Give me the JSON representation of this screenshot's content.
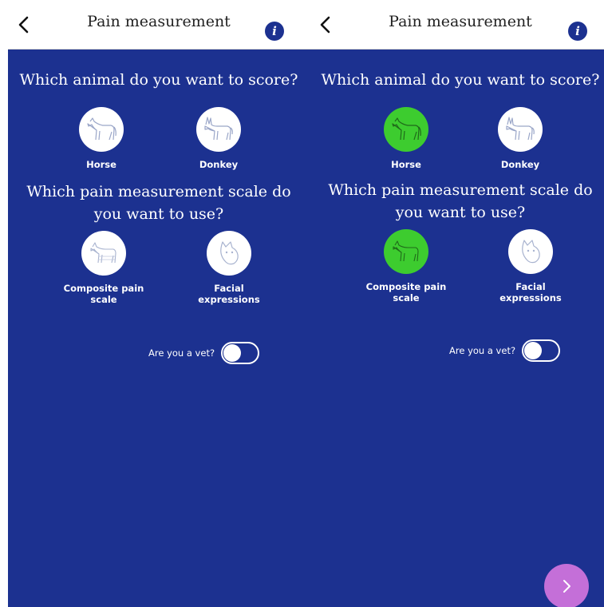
{
  "screens": [
    {
      "header": {
        "title": "Pain measurement"
      },
      "animal_question": "Which animal do you want to score?",
      "animals": [
        {
          "label": "Horse",
          "icon": "horse-icon",
          "selected": false
        },
        {
          "label": "Donkey",
          "icon": "donkey-icon",
          "selected": false
        }
      ],
      "scale_question_line1": "Which pain measurement scale do",
      "scale_question_line2": "you want to use?",
      "scales": [
        {
          "label_line1": "Composite pain",
          "label_line2": "scale",
          "icon": "horse-body-icon",
          "selected": false
        },
        {
          "label_line1": "Facial",
          "label_line2": "expressions",
          "icon": "horse-face-icon",
          "selected": false
        }
      ],
      "vet_label": "Are you a vet?",
      "vet_toggle_on": false
    },
    {
      "header": {
        "title": "Pain measurement"
      },
      "animal_question": "Which animal do you want to score?",
      "animals": [
        {
          "label": "Horse",
          "icon": "horse-icon",
          "selected": true
        },
        {
          "label": "Donkey",
          "icon": "donkey-icon",
          "selected": false
        }
      ],
      "scale_question_line1": "Which pain measurement scale do",
      "scale_question_line2": "you want to use?",
      "scales": [
        {
          "label_line1": "Composite pain",
          "label_line2": "scale",
          "icon": "horse-body-icon",
          "selected": true
        },
        {
          "label_line1": "Facial",
          "label_line2": "expressions",
          "icon": "horse-face-icon",
          "selected": false
        }
      ],
      "vet_label": "Are you a vet?",
      "vet_toggle_on": false,
      "next_button": {
        "icon": "chevron-right-icon"
      }
    }
  ],
  "colors": {
    "background": "#1c3190",
    "selected": "#3dcc2f",
    "next_button": "#c46fd8",
    "header_bg": "#ffffff"
  }
}
